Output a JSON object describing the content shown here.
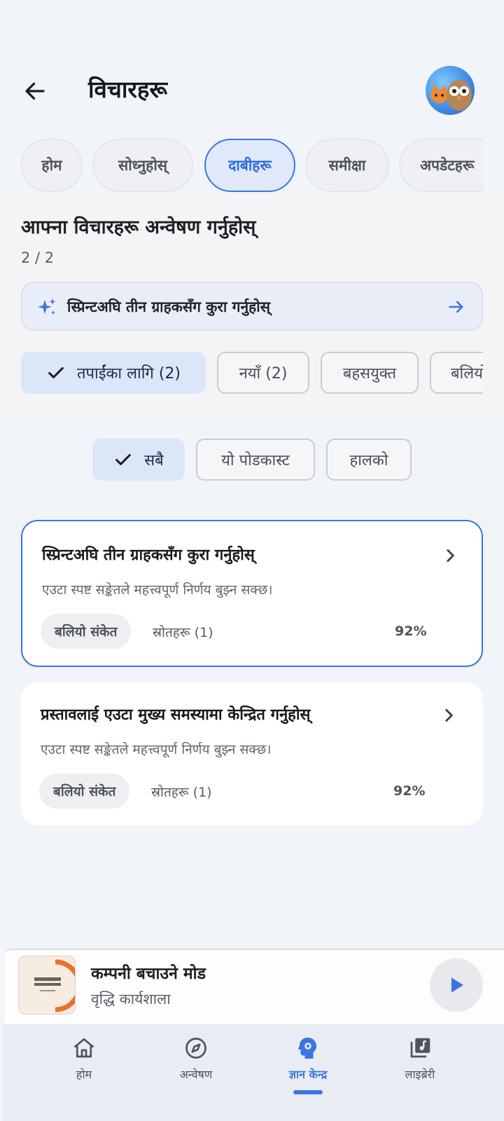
{
  "header": {
    "title": "विचारहरू"
  },
  "tabs": [
    {
      "label": "होम",
      "active": false
    },
    {
      "label": "सोध्नुहोस्",
      "active": false
    },
    {
      "label": "दाबीहरू",
      "active": true
    },
    {
      "label": "समीक्षा",
      "active": false
    },
    {
      "label": "अपडेटहरू",
      "active": false
    }
  ],
  "explore": {
    "title": "आफ्ना विचारहरू अन्वेषण गर्नुहोस्",
    "counter": "2 / 2",
    "suggestion": "स्प्रिन्टअघि तीन ग्राहकसँग कुरा गर्नुहोस्"
  },
  "filters_primary": [
    {
      "label": "तपाईंका लागि (2)",
      "selected": true
    },
    {
      "label": "नयाँ (2)",
      "selected": false
    },
    {
      "label": "बहसयुक्त",
      "selected": false
    },
    {
      "label": "बलियो",
      "selected": false
    }
  ],
  "filters_scope": [
    {
      "label": "सबै",
      "selected": true
    },
    {
      "label": "यो पोडकास्ट",
      "selected": false
    },
    {
      "label": "हालको",
      "selected": false
    }
  ],
  "cards": [
    {
      "title": "स्प्रिन्टअघि तीन ग्राहकसँग कुरा गर्नुहोस्",
      "description": "एउटा स्पष्ट सङ्केतले महत्त्वपूर्ण निर्णय बुझ्न सक्छ।",
      "badge": "बलियो संकेत",
      "sources": "स्रोतहरू (1)",
      "confidence": "92%",
      "active": true
    },
    {
      "title": "प्रस्तावलाई एउटा मुख्य समस्यामा केन्द्रित गर्नुहोस्",
      "description": "एउटा स्पष्ट सङ्केतले महत्त्वपूर्ण निर्णय बुझ्न सक्छ।",
      "badge": "बलियो संकेत",
      "sources": "स्रोतहरू (1)",
      "confidence": "92%",
      "active": false
    }
  ],
  "player": {
    "title": "कम्पनी बचाउने मोड",
    "subtitle": "वृद्धि कार्यशाला"
  },
  "nav": [
    {
      "label": "होम",
      "icon": "home-icon",
      "active": false
    },
    {
      "label": "अन्वेषण",
      "icon": "compass-icon",
      "active": false
    },
    {
      "label": "ज्ञान केन्द्र",
      "icon": "brain-gear-icon",
      "active": true
    },
    {
      "label": "लाइब्रेरी",
      "icon": "library-music-icon",
      "active": false
    }
  ],
  "colors": {
    "accent": "#3a76e0",
    "background": "#f1f4f9",
    "card": "#ffffff"
  }
}
